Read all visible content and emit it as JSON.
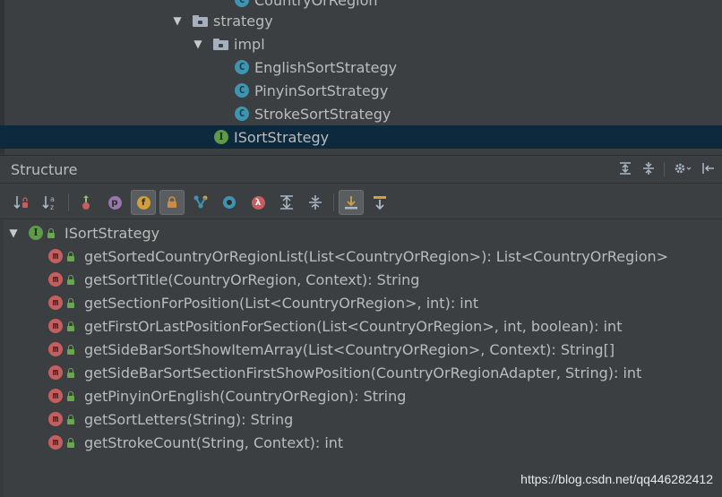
{
  "tree": {
    "partial_top": "CountryOrRegion",
    "items": [
      {
        "label": "strategy",
        "type": "package"
      },
      {
        "label": "impl",
        "type": "package"
      },
      {
        "label": "EnglishSortStrategy",
        "type": "class"
      },
      {
        "label": "PinyinSortStrategy",
        "type": "class"
      },
      {
        "label": "StrokeSortStrategy",
        "type": "class"
      },
      {
        "label": "ISortStrategy",
        "type": "interface",
        "selected": true
      }
    ],
    "icon_letters": {
      "class": "C",
      "interface": "I"
    }
  },
  "structure": {
    "title": "Structure",
    "toolbar_icons": [
      "sort-by-visibility-icon",
      "sort-alphabetically-icon",
      "show-inherited-icon",
      "show-properties-icon",
      "show-fields-icon",
      "show-non-public-icon",
      "show-anonymous-classes-icon",
      "show-lambdas-icon",
      "show-ordinal-icon",
      "expand-all-icon",
      "collapse-all-icon",
      "autoscroll-to-source-icon",
      "autoscroll-from-source-icon"
    ],
    "toolbar_letters": {
      "p": "p",
      "f": "f",
      "lambda": "λ"
    },
    "root": "ISortStrategy",
    "methods": [
      "getSortedCountryOrRegionList(List<CountryOrRegion>): List<CountryOrRegion>",
      "getSortTitle(CountryOrRegion, Context): String",
      "getSectionForPosition(List<CountryOrRegion>, int): int",
      "getFirstOrLastPositionForSection(List<CountryOrRegion>, int, boolean): int",
      "getSideBarSortShowItemArray(List<CountryOrRegion>, Context): String[]",
      "getSideBarSortSectionFirstShowPosition(CountryOrRegionAdapter, String): int",
      "getPinyinOrEnglish(CountryOrRegion): String",
      "getSortLetters(String): String",
      "getStrokeCount(String, Context): int"
    ],
    "method_icon_letter": "m"
  },
  "watermark": "https://blog.csdn.net/qq446282412",
  "colors": {
    "background": "#3c3f41",
    "selection": "#0d293e",
    "class_icon": "#3d95b2",
    "interface_icon": "#5f9a4a",
    "method_icon": "#c55e5e"
  }
}
